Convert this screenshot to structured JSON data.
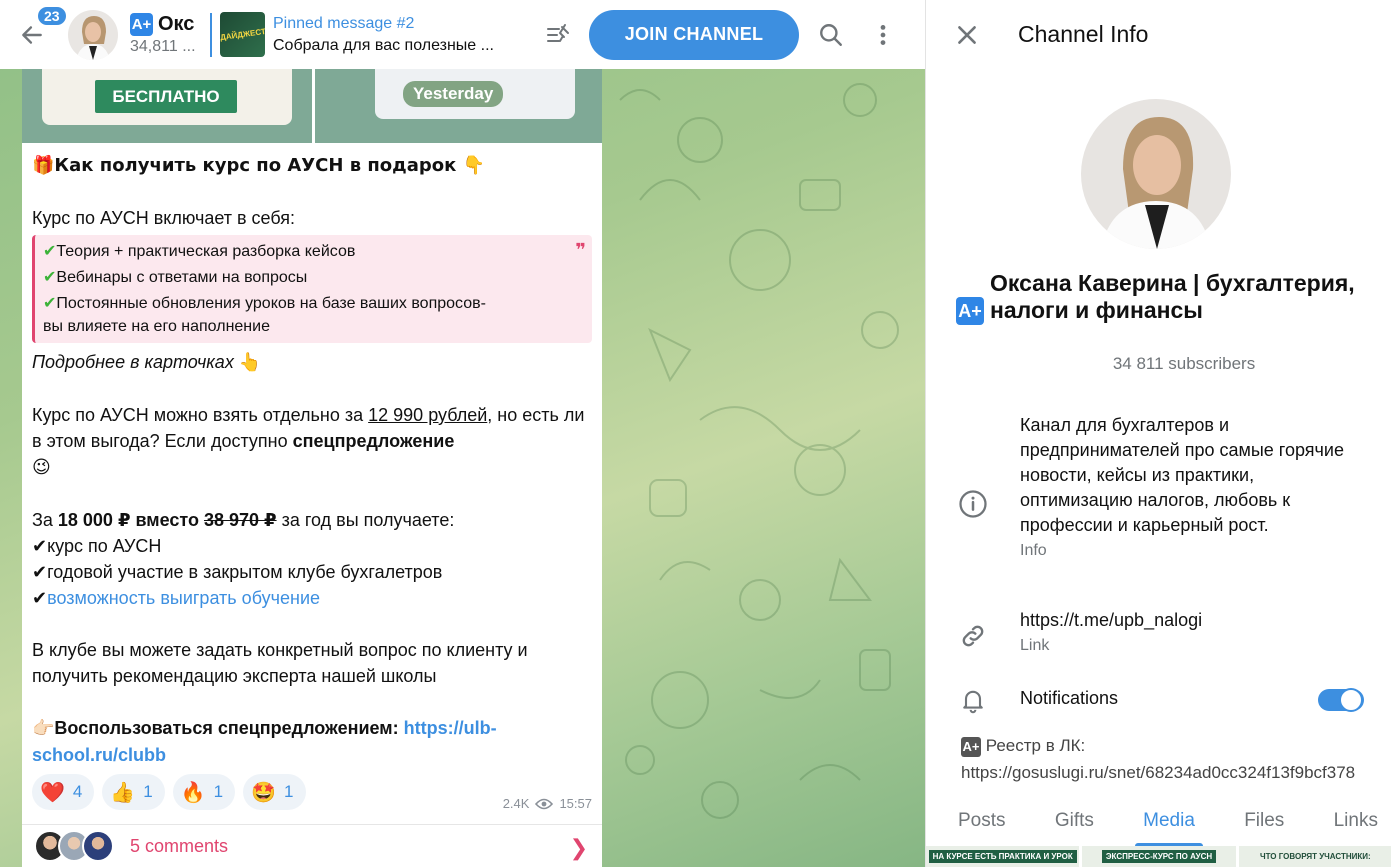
{
  "header": {
    "unread_count": "23",
    "channel_short": "Окс",
    "subscribers_short": "34,811 ...",
    "pinned_title": "Pinned message #2",
    "pinned_text": "Собрала для вас полезные ...",
    "pinned_thumb_text": "ДАЙДЖЕСТ",
    "join_label": "JOIN CHANNEL"
  },
  "message": {
    "media_left_label": "БЕСПЛАТНО",
    "date_chip": "Yesterday",
    "line_gift": "🎁Как получить курс по АУСН в подарок 👇",
    "line_includes": "Курс по АУСН включает в себя:",
    "quote_1": "Теория + практическая разборка кейсов",
    "quote_2": "Вебинары с ответами на вопросы",
    "quote_3a": "Постоянные обновления уроков на базе ваших вопросов-",
    "quote_3b": "вы влияете на его наполнение",
    "line_details": "Подробнее в карточках",
    "details_emoji": "👆",
    "p1_a": "Курс по АУСН можно взять отдельно за ",
    "p1_price": "12 990 рублей",
    "p1_b": ", но есть ли в этом выгода? Если доступно ",
    "p1_bold": "спецпредложение",
    "p1_emoji": "😉",
    "p2_a": "За ",
    "p2_bold": "18 000 ₽ вместо ",
    "p2_strike": "38 970 ₽",
    "p2_b": " за год вы получаете:",
    "item_1": "курс по АУСН",
    "item_2": "годовой участие в закрытом клубе бухгалетров",
    "item_3": "возможность выиграть обучение",
    "p3": "В клубе вы можете задать конкретный вопрос по клиенту и получить рекомендацию эксперта нашей школы",
    "cta_bold": "Воспользоваться спецпредложением: ",
    "cta_link": "https://ulb-school.ru/clubb",
    "reactions": [
      {
        "emoji": "❤️",
        "count": "4"
      },
      {
        "emoji": "👍",
        "count": "1"
      },
      {
        "emoji": "🔥",
        "count": "1"
      },
      {
        "emoji": "🤩",
        "count": "1"
      }
    ],
    "views": "2.4K",
    "time": "15:57",
    "comments": "5 comments"
  },
  "info": {
    "title": "Channel Info",
    "name": "Оксана Каверина | бухгалтерия, налоги и финансы",
    "subscribers": "34 811 subscribers",
    "description": "Канал для бухгалтеров и предпринимателей про самые горячие новости, кейсы из практики, оптимизацию налогов, любовь к профессии и карьерный рост.",
    "description_label": "Info",
    "link": "https://t.me/upb_nalogi",
    "link_label": "Link",
    "notifications_label": "Notifications",
    "notifications_on": true,
    "registry_label": "Реестр в ЛК:",
    "registry_url": "https://gosuslugi.ru/snet/68234ad0cc324f13f9bcf378",
    "tabs": [
      "Posts",
      "Gifts",
      "Media",
      "Files",
      "Links"
    ],
    "active_tab": "Media",
    "media_thumbs": [
      "НА КУРСЕ ЕСТЬ ПРАКТИКА И УРОК",
      "ЭКСПРЕСС-КУРС ПО АУСН",
      "ЧТО ГОВОРЯТ УЧАСТНИКИ:"
    ]
  },
  "colors": {
    "accent": "#3d8fe0",
    "quote_border": "#e0456f",
    "comments": "#e0456f",
    "chat_bg": "#a6c98f"
  }
}
